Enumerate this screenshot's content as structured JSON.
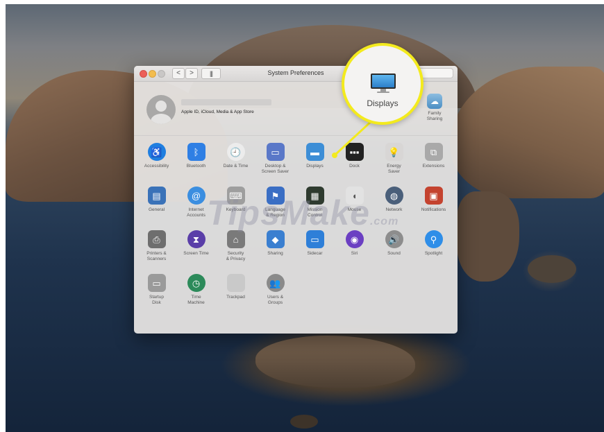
{
  "window": {
    "title": "System Preferences",
    "nav_back": "<",
    "nav_forward": ">",
    "grid_button": "|||"
  },
  "account": {
    "subtitle": "Apple ID, iCloud, Media & App Store"
  },
  "family_sharing": {
    "label_line1": "Family",
    "label_line2": "Sharing",
    "icon": "family-cloud-icon"
  },
  "prefs": [
    {
      "id": "accessibility",
      "line1": "Accessibility",
      "line2": "",
      "glyph": "♿",
      "bg": "#1f7ee0",
      "shape": "circle"
    },
    {
      "id": "bluetooth",
      "line1": "Bluetooth",
      "line2": "",
      "glyph": "ᛒ",
      "bg": "#2f7fe4",
      "shape": "rounded"
    },
    {
      "id": "date-time",
      "line1": "Date & Time",
      "line2": "",
      "glyph": "🕘",
      "bg": "#ececec",
      "shape": "circle"
    },
    {
      "id": "desktop-screen-saver",
      "line1": "Desktop &",
      "line2": "Screen Saver",
      "glyph": "▭",
      "bg": "#5a78c8",
      "shape": "rounded"
    },
    {
      "id": "displays",
      "line1": "Displays",
      "line2": "",
      "glyph": "▬",
      "bg": "#3d8ed6",
      "shape": "rounded"
    },
    {
      "id": "dock",
      "line1": "Dock",
      "line2": "",
      "glyph": "▪▪▪",
      "bg": "#222222",
      "shape": "rounded"
    },
    {
      "id": "energy-saver",
      "line1": "Energy",
      "line2": "Saver",
      "glyph": "💡",
      "bg": "#d8d6d5",
      "shape": "rounded"
    },
    {
      "id": "extensions",
      "line1": "Extensions",
      "line2": "",
      "glyph": "⧉",
      "bg": "#a9a9a9",
      "shape": "rounded"
    },
    {
      "id": "general",
      "line1": "General",
      "line2": "",
      "glyph": "▤",
      "bg": "#3a72b8",
      "shape": "rounded"
    },
    {
      "id": "internet-accounts",
      "line1": "Internet",
      "line2": "Accounts",
      "glyph": "@",
      "bg": "#3b8ee0",
      "shape": "circle"
    },
    {
      "id": "keyboard",
      "line1": "Keyboard",
      "line2": "",
      "glyph": "⌨",
      "bg": "#9e9e9e",
      "shape": "rounded"
    },
    {
      "id": "language-region",
      "line1": "Language",
      "line2": "& Region",
      "glyph": "⚑",
      "bg": "#3a6ec4",
      "shape": "rounded"
    },
    {
      "id": "mission-control",
      "line1": "Mission",
      "line2": "Control",
      "glyph": "▦",
      "bg": "#2f3b2f",
      "shape": "rounded"
    },
    {
      "id": "mouse",
      "line1": "Mouse",
      "line2": "",
      "glyph": "◖",
      "bg": "#e2e2e2",
      "shape": "rounded"
    },
    {
      "id": "network",
      "line1": "Network",
      "line2": "",
      "glyph": "◍",
      "bg": "#4a5f7a",
      "shape": "circle"
    },
    {
      "id": "notifications",
      "line1": "Notifications",
      "line2": "",
      "glyph": "▣",
      "bg": "#c4432f",
      "shape": "rounded"
    },
    {
      "id": "printers-scanners",
      "line1": "Printers &",
      "line2": "Scanners",
      "glyph": "⎙",
      "bg": "#6e6e6e",
      "shape": "rounded"
    },
    {
      "id": "screen-time",
      "line1": "Screen Time",
      "line2": "",
      "glyph": "⧗",
      "bg": "#5a3ea8",
      "shape": "circle"
    },
    {
      "id": "security-privacy",
      "line1": "Security",
      "line2": "& Privacy",
      "glyph": "⌂",
      "bg": "#7a7a7a",
      "shape": "rounded"
    },
    {
      "id": "sharing",
      "line1": "Sharing",
      "line2": "",
      "glyph": "◆",
      "bg": "#3a7fd0",
      "shape": "rounded"
    },
    {
      "id": "sidecar",
      "line1": "Sidecar",
      "line2": "",
      "glyph": "▭",
      "bg": "#2e7fd8",
      "shape": "rounded"
    },
    {
      "id": "siri",
      "line1": "Siri",
      "line2": "",
      "glyph": "◉",
      "bg": "#6b3fc2",
      "shape": "circle"
    },
    {
      "id": "sound",
      "line1": "Sound",
      "line2": "",
      "glyph": "🔊",
      "bg": "#8d8d8d",
      "shape": "circle"
    },
    {
      "id": "spotlight",
      "line1": "Spotlight",
      "line2": "",
      "glyph": "⚲",
      "bg": "#2f8ee8",
      "shape": "circle"
    },
    {
      "id": "startup-disk",
      "line1": "Startup",
      "line2": "Disk",
      "glyph": "▭",
      "bg": "#9a9a9a",
      "shape": "rounded"
    },
    {
      "id": "time-machine",
      "line1": "Time",
      "line2": "Machine",
      "glyph": "◷",
      "bg": "#2c8a5a",
      "shape": "circle"
    },
    {
      "id": "trackpad",
      "line1": "Trackpad",
      "line2": "",
      "glyph": "",
      "bg": "#c9c9c9",
      "shape": "rounded"
    },
    {
      "id": "users-groups",
      "line1": "Users &",
      "line2": "Groups",
      "glyph": "👥",
      "bg": "#8a8a8a",
      "shape": "circle"
    }
  ],
  "callout": {
    "label": "Displays"
  },
  "watermark": {
    "text": "TipsMake",
    "suffix": ".com"
  }
}
